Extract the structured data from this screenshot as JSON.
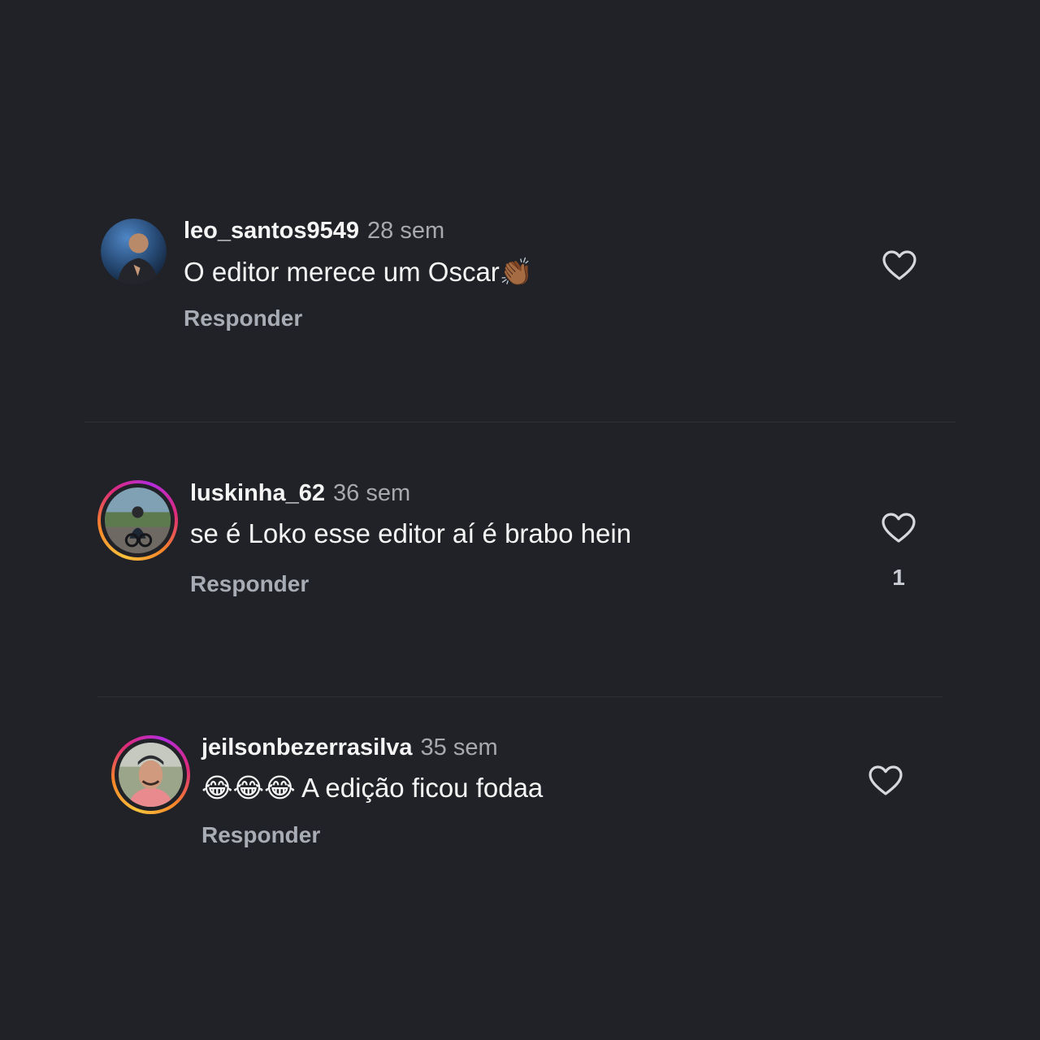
{
  "comments": [
    {
      "username": "leo_santos9549",
      "time": "28 sem",
      "text": "O editor merece um Oscar",
      "emoji": "👏🏾",
      "reply_label": "Responder",
      "likes": ""
    },
    {
      "username": "luskinha_62",
      "time": "36 sem",
      "text": "se é Loko esse editor aí é brabo hein",
      "emoji": "",
      "reply_label": "Responder",
      "likes": "1"
    },
    {
      "username": "jeilsonbezerrasilva",
      "time": "35 sem",
      "text": "A edição ficou fodaa",
      "emoji": "😂😂😂",
      "reply_label": "Responder",
      "likes": ""
    }
  ],
  "icons": {
    "like": "heart-outline-icon"
  },
  "colors": {
    "background": "#212227",
    "username": "#f5f5f5",
    "meta": "#a8a8ad",
    "story_ring": [
      "#f9c23c",
      "#f58529",
      "#dd2a7b",
      "#b42ce0"
    ]
  }
}
